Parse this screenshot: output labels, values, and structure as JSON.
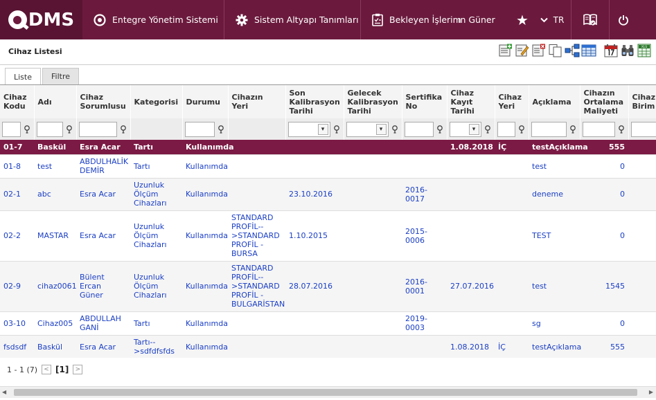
{
  "header": {
    "logo_text": "DMS",
    "nav": [
      {
        "label": "Entegre Yönetim Sistemi",
        "icon": "target-icon"
      },
      {
        "label": "Sistem Altyapı Tanımları",
        "icon": "gear-icon"
      },
      {
        "label": "Bekleyen İşlerim",
        "icon": "clipboard-icon"
      }
    ],
    "user": "ın Güner",
    "lang": "TR",
    "brand_color": "#6b1a3d",
    "selected_row_color": "#7b1a44"
  },
  "page": {
    "title": "Cihaz Listesi"
  },
  "tabs": [
    {
      "label": "Liste",
      "active": true
    },
    {
      "label": "Filtre",
      "active": false
    }
  ],
  "columns": [
    "Cihaz Kodu",
    "Adı",
    "Cihaz Sorumlusu",
    "Kategorisi",
    "Durumu",
    "Cihazın Yeri",
    "Son Kalibrasyon Tarihi",
    "Gelecek Kalibrasyon Tarihi",
    "Sertifika No",
    "Cihaz Kayıt Tarihi",
    "Cihaz Yeri",
    "Açıklama",
    "Cihazın Ortalama Maliyeti",
    "Cihaz Birim"
  ],
  "rows": [
    [
      "01-7",
      "Baskül",
      "Esra Acar",
      "Tartı",
      "Kullanımda",
      "",
      "",
      "",
      "",
      "1.08.2018",
      "İÇ",
      "testAçıklama",
      "555",
      ""
    ],
    [
      "01-8",
      "test",
      "ABDULHALİK DEMİR",
      "Tartı",
      "Kullanımda",
      "",
      "",
      "",
      "",
      "",
      "",
      "test",
      "0",
      ""
    ],
    [
      "02-1",
      "abc",
      "Esra Acar",
      "Uzunluk Ölçüm Cihazları",
      "Kullanımda",
      "",
      "23.10.2016",
      "",
      "2016-0017",
      "",
      "",
      "deneme",
      "0",
      ""
    ],
    [
      "02-2",
      "MASTAR",
      "Esra Acar",
      "Uzunluk Ölçüm Cihazları",
      "Kullanımda",
      "STANDARD PROFİL-->STANDARD PROFİL - BURSA",
      "1.10.2015",
      "",
      "2015-0006",
      "",
      "",
      "TEST",
      "0",
      ""
    ],
    [
      "02-9",
      "cihaz0061",
      "Bülent Ercan Güner",
      "Uzunluk Ölçüm Cihazları",
      "Kullanımda",
      "STANDARD PROFİL-->STANDARD PROFİL - BULGARİSTAN",
      "28.07.2016",
      "",
      "2016-0001",
      "27.07.2016",
      "",
      "test",
      "1545",
      ""
    ],
    [
      "03-10",
      "Cihaz005",
      "ABDULLAH GANİ",
      "Tartı",
      "Kullanımda",
      "",
      "",
      "",
      "2019-0003",
      "",
      "",
      "sg",
      "0",
      ""
    ],
    [
      "fsdsdf",
      "Baskül",
      "Esra Acar",
      "Tartı-->sdfdfsfds",
      "Kullanımda",
      "",
      "",
      "",
      "",
      "1.08.2018",
      "İÇ",
      "testAçıklama",
      "555",
      ""
    ]
  ],
  "pager": {
    "range": "1 - 1 (7)",
    "current": "[1]"
  }
}
